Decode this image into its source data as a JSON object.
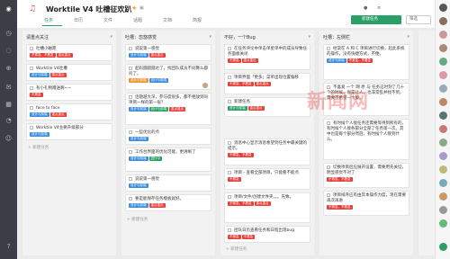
{
  "app": {
    "title": "Worktile V4 吐槽征欢趴",
    "new_task": "新建任务",
    "filter": "筛选"
  },
  "tabs": [
    "任务",
    "日历",
    "文件",
    "话题",
    "文档",
    "简报"
  ],
  "colors": {
    "green": "#2aa066",
    "red": "#e8413a",
    "blue": "#3b8de0",
    "orange": "#f0952e"
  },
  "columns": [
    {
      "title": "请重点关注",
      "add": "+ 新建任务"
    },
    {
      "title": "吐槽：忽悠感觉",
      "add": "+ 新建任务"
    },
    {
      "title": "不好，一个Bug",
      "add": "+ 新建任务"
    },
    {
      "title": "吐槽：左侧栏",
      "add": ""
    }
  ],
  "cards": {
    "c1": [
      {
        "text": "吐槽小磁距",
        "tags": [
          "不紧急、不着急",
          "重点重点"
        ]
      },
      {
        "text": "Worktile V4吐槽",
        "tags": [
          "设计与前端",
          "重点重点"
        ]
      },
      {
        "text": "有小礼物赠送啊~~",
        "tags": [
          "不紧急"
        ]
      },
      {
        "text": "face to face",
        "tags": [
          "设计与前端",
          "重点重点"
        ]
      },
      {
        "text": "Worktile V4主要升级部分",
        "tags": [
          "设计与前端"
        ]
      }
    ],
    "c2": [
      {
        "text": "说说第一感觉",
        "tags": [
          "设计与前端",
          "重点重点"
        ]
      },
      {
        "text": "起码圆圆圆达了，找回队成员不同算么都问了。",
        "tags": [
          "设计与前端",
          "设计与前端"
        ]
      },
      {
        "text": "话题越大深，参与度很多，都不相放到同项目一样的第一层？",
        "tags": [
          "设计与前端",
          "设计与前端",
          "重点重点"
        ]
      },
      {
        "text": "一些优化的点",
        "tags": [
          "设计与前端"
        ]
      },
      {
        "text": "工作台界面的优化可能，更清晰了",
        "tags": [
          "设计与前端",
          "进行中"
        ]
      },
      {
        "text": "说说第一感觉",
        "tags": [
          "设计与前端"
        ]
      },
      {
        "text": "要是能保存任务模板就好。",
        "tags": [
          "设计与前端",
          "重点重点"
        ]
      }
    ],
    "c3": [
      {
        "text": "在任务评论中单击单星单中的成员导致任务面板关闭",
        "tags": [
          "不紧急",
          "重点重点"
        ]
      },
      {
        "text": "项目界面「更多」菜单出现位置偏移",
        "tags": [
          "不紧急、不着急",
          "重点重点"
        ]
      },
      {
        "text": "新建任务",
        "tags": [
          "设计与前端",
          "重点重点"
        ]
      },
      {
        "text": "消息中心显示消息希望到任务中最关键的提示。",
        "tags": [
          "不紧急、不着急"
        ]
      },
      {
        "text": "项目 - 查看全部项目，只能看不能点",
        "tags": [
          "不紧急"
        ]
      },
      {
        "text": "项目/文件/创建文件夹，。。先致。",
        "tags": [
          "不紧急、不着急",
          "重点重点"
        ]
      },
      {
        "text": "团队日历查看任务和日程出现bug",
        "tags": [
          "不紧急",
          "不紧急"
        ]
      }
    ],
    "c4": [
      {
        "text": "经常在 A 和 C 项目进行切换，起此系统的操作，没有快捷方式，不便。",
        "tags": [
          "设计与前端",
          "不紧急、不着急"
        ]
      },
      {
        "text": "不喜爱 一个 网 原 与 任务这时刻了几十个的时候，很是让人，也非常乱并找不到，需要不希望一个版，",
        "tags": []
      },
      {
        "text": "有时候个人接任务还需要等待到所有的，有时候个人接各部分全部了任务第一次。其中也是每个部分然后，有时候个人接到什么。",
        "tags": []
      },
      {
        "text": "切换项目后应展开设置，需要用先关切，明显感觉不对了",
        "tags": [
          "不紧急、不着急"
        ]
      },
      {
        "text": "项目排序应有由其本操作力度，现在需要再次再进",
        "tags": [
          "不紧急、不着急"
        ]
      }
    ]
  }
}
